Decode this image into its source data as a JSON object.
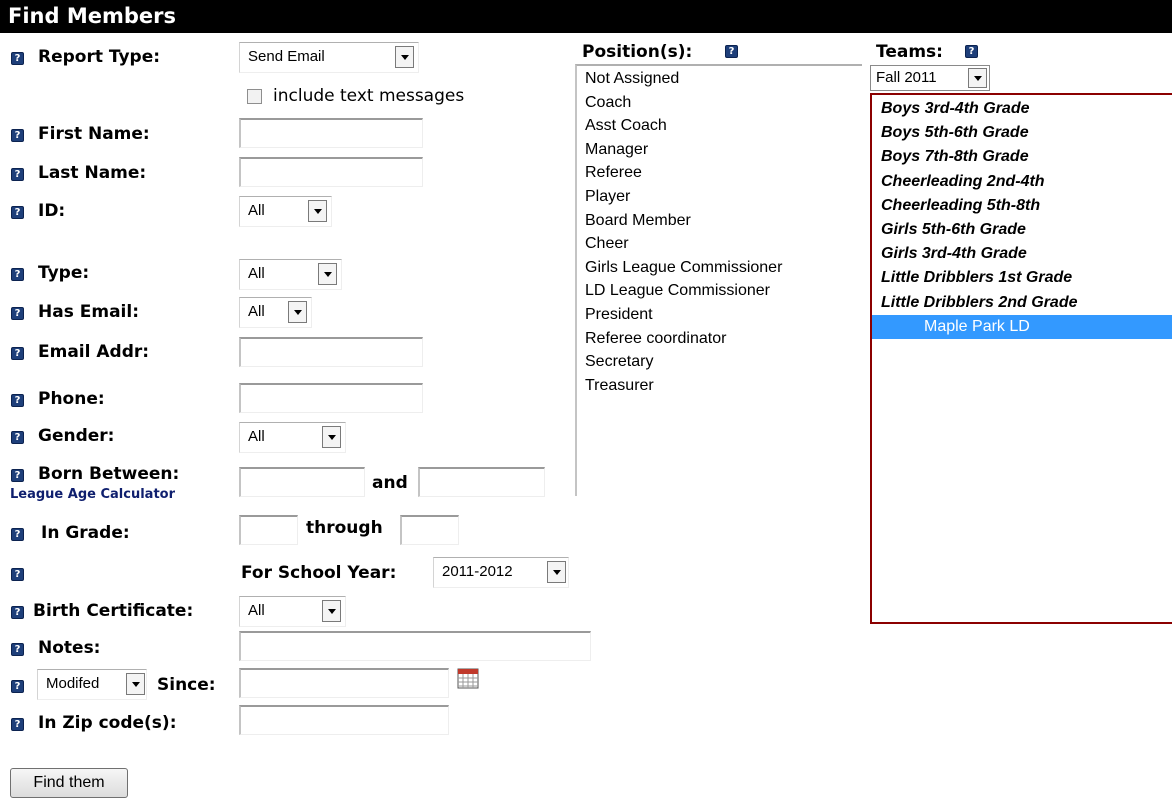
{
  "title": "Find Members",
  "labels": {
    "report_type": "Report Type:",
    "first_name": "First Name:",
    "last_name": "Last Name:",
    "id": "ID:",
    "type": "Type:",
    "has_email": "Has Email:",
    "email_addr": "Email Addr:",
    "phone": "Phone:",
    "gender": "Gender:",
    "born_between": "Born Between:",
    "and": "and",
    "league_age_calculator": "League Age Calculator",
    "in_grade": "In Grade:",
    "through": "through",
    "for_school_year": "For School Year:",
    "birth_certificate": "Birth Certificate:",
    "notes": "Notes:",
    "since": "Since:",
    "in_zip_codes": "In Zip code(s):",
    "positions": "Position(s):",
    "teams": "Teams:"
  },
  "help_glyph": "?",
  "report_type_value": "Send Email",
  "include_text_messages": "include text messages",
  "id_value": "All",
  "type_value": "All",
  "has_email_value": "All",
  "gender_value": "All",
  "school_year_value": "2011-2012",
  "birth_certificate_value": "All",
  "modified_value": "Modifed",
  "teams_season": "Fall 2011",
  "positions": [
    "Not Assigned",
    "Coach",
    "Asst Coach",
    "Manager",
    "Referee",
    "Player",
    "Board Member",
    "Cheer",
    "Girls League Commissioner",
    "LD League Commissioner",
    "President",
    "Referee coordinator",
    "Secretary",
    "Treasurer"
  ],
  "teams": [
    "Boys 3rd-4th Grade",
    "Boys 5th-6th Grade",
    "Boys 7th-8th Grade",
    "Cheerleading 2nd-4th",
    "Cheerleading 5th-8th",
    "Girls 5th-6th Grade",
    "Girls 3rd-4th Grade",
    "Little Dribblers 1st Grade",
    "Little Dribblers 2nd Grade",
    "Maple Park LD"
  ],
  "selected_team": "Maple Park LD",
  "find_button": "Find them",
  "colors": {
    "help_icon": "#1e3f7a",
    "selection": "#3399ff",
    "teams_border": "#8b0000",
    "league_link": "#0f1f6e"
  },
  "icons": {
    "help": "help-icon",
    "calendar": "calendar-icon",
    "dropdown": "chevron-down-icon"
  }
}
